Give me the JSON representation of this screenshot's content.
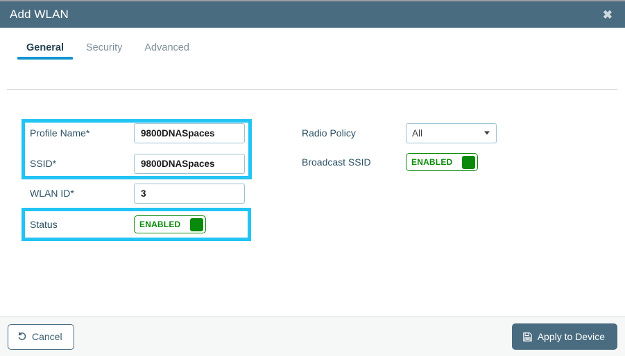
{
  "window": {
    "title": "Add WLAN",
    "close_label": "✖",
    "header_color": "#4a6c80"
  },
  "tabs": [
    {
      "label": "General",
      "active": true
    },
    {
      "label": "Security",
      "active": false
    },
    {
      "label": "Advanced",
      "active": false
    }
  ],
  "form": {
    "left": {
      "profile_name": {
        "label": "Profile Name*",
        "value": "9800DNASpaces",
        "placeholder": ""
      },
      "ssid": {
        "label": "SSID*",
        "value": "9800DNASpaces",
        "placeholder": ""
      },
      "wlan_id": {
        "label": "WLAN ID*",
        "value": "3",
        "placeholder": ""
      },
      "status": {
        "label": "Status",
        "toggle_text": "ENABLED",
        "toggle_color": "#0a8a0a"
      }
    },
    "right": {
      "radio_policy": {
        "label": "Radio Policy",
        "value": "All",
        "options": [
          "All"
        ]
      },
      "broadcast_ssid": {
        "label": "Broadcast SSID",
        "toggle_text": "ENABLED",
        "toggle_color": "#0a8a0a"
      }
    }
  },
  "highlights": {
    "color": "#22c4f4",
    "regions": [
      "profile-name-and-ssid",
      "status"
    ]
  },
  "footer": {
    "cancel_label": "Cancel",
    "apply_label": "Apply to Device"
  }
}
